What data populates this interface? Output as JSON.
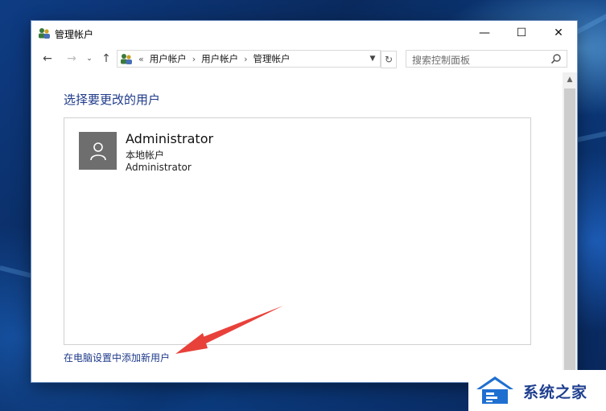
{
  "window": {
    "title": "管理帐户",
    "controls": {
      "minimize": "—",
      "maximize": "☐",
      "close": "✕"
    }
  },
  "navigation": {
    "back": "←",
    "forward": "→",
    "recent": "⌄",
    "up": "↑",
    "breadcrumb_prefix": "«",
    "breadcrumb": [
      "用户帐户",
      "用户帐户",
      "管理帐户"
    ],
    "separator": "›",
    "refresh": "↻"
  },
  "search": {
    "placeholder": "搜索控制面板"
  },
  "main": {
    "heading": "选择要更改的用户",
    "users": [
      {
        "name": "Administrator",
        "type": "本地帐户",
        "role": "Administrator"
      }
    ],
    "add_user_link": "在电脑设置中添加新用户"
  },
  "watermark": {
    "text": "系统之家"
  },
  "colors": {
    "link_blue": "#1e3a8a",
    "annotation_arrow": "#e8413a",
    "user_tile": "#6e6e6e"
  }
}
